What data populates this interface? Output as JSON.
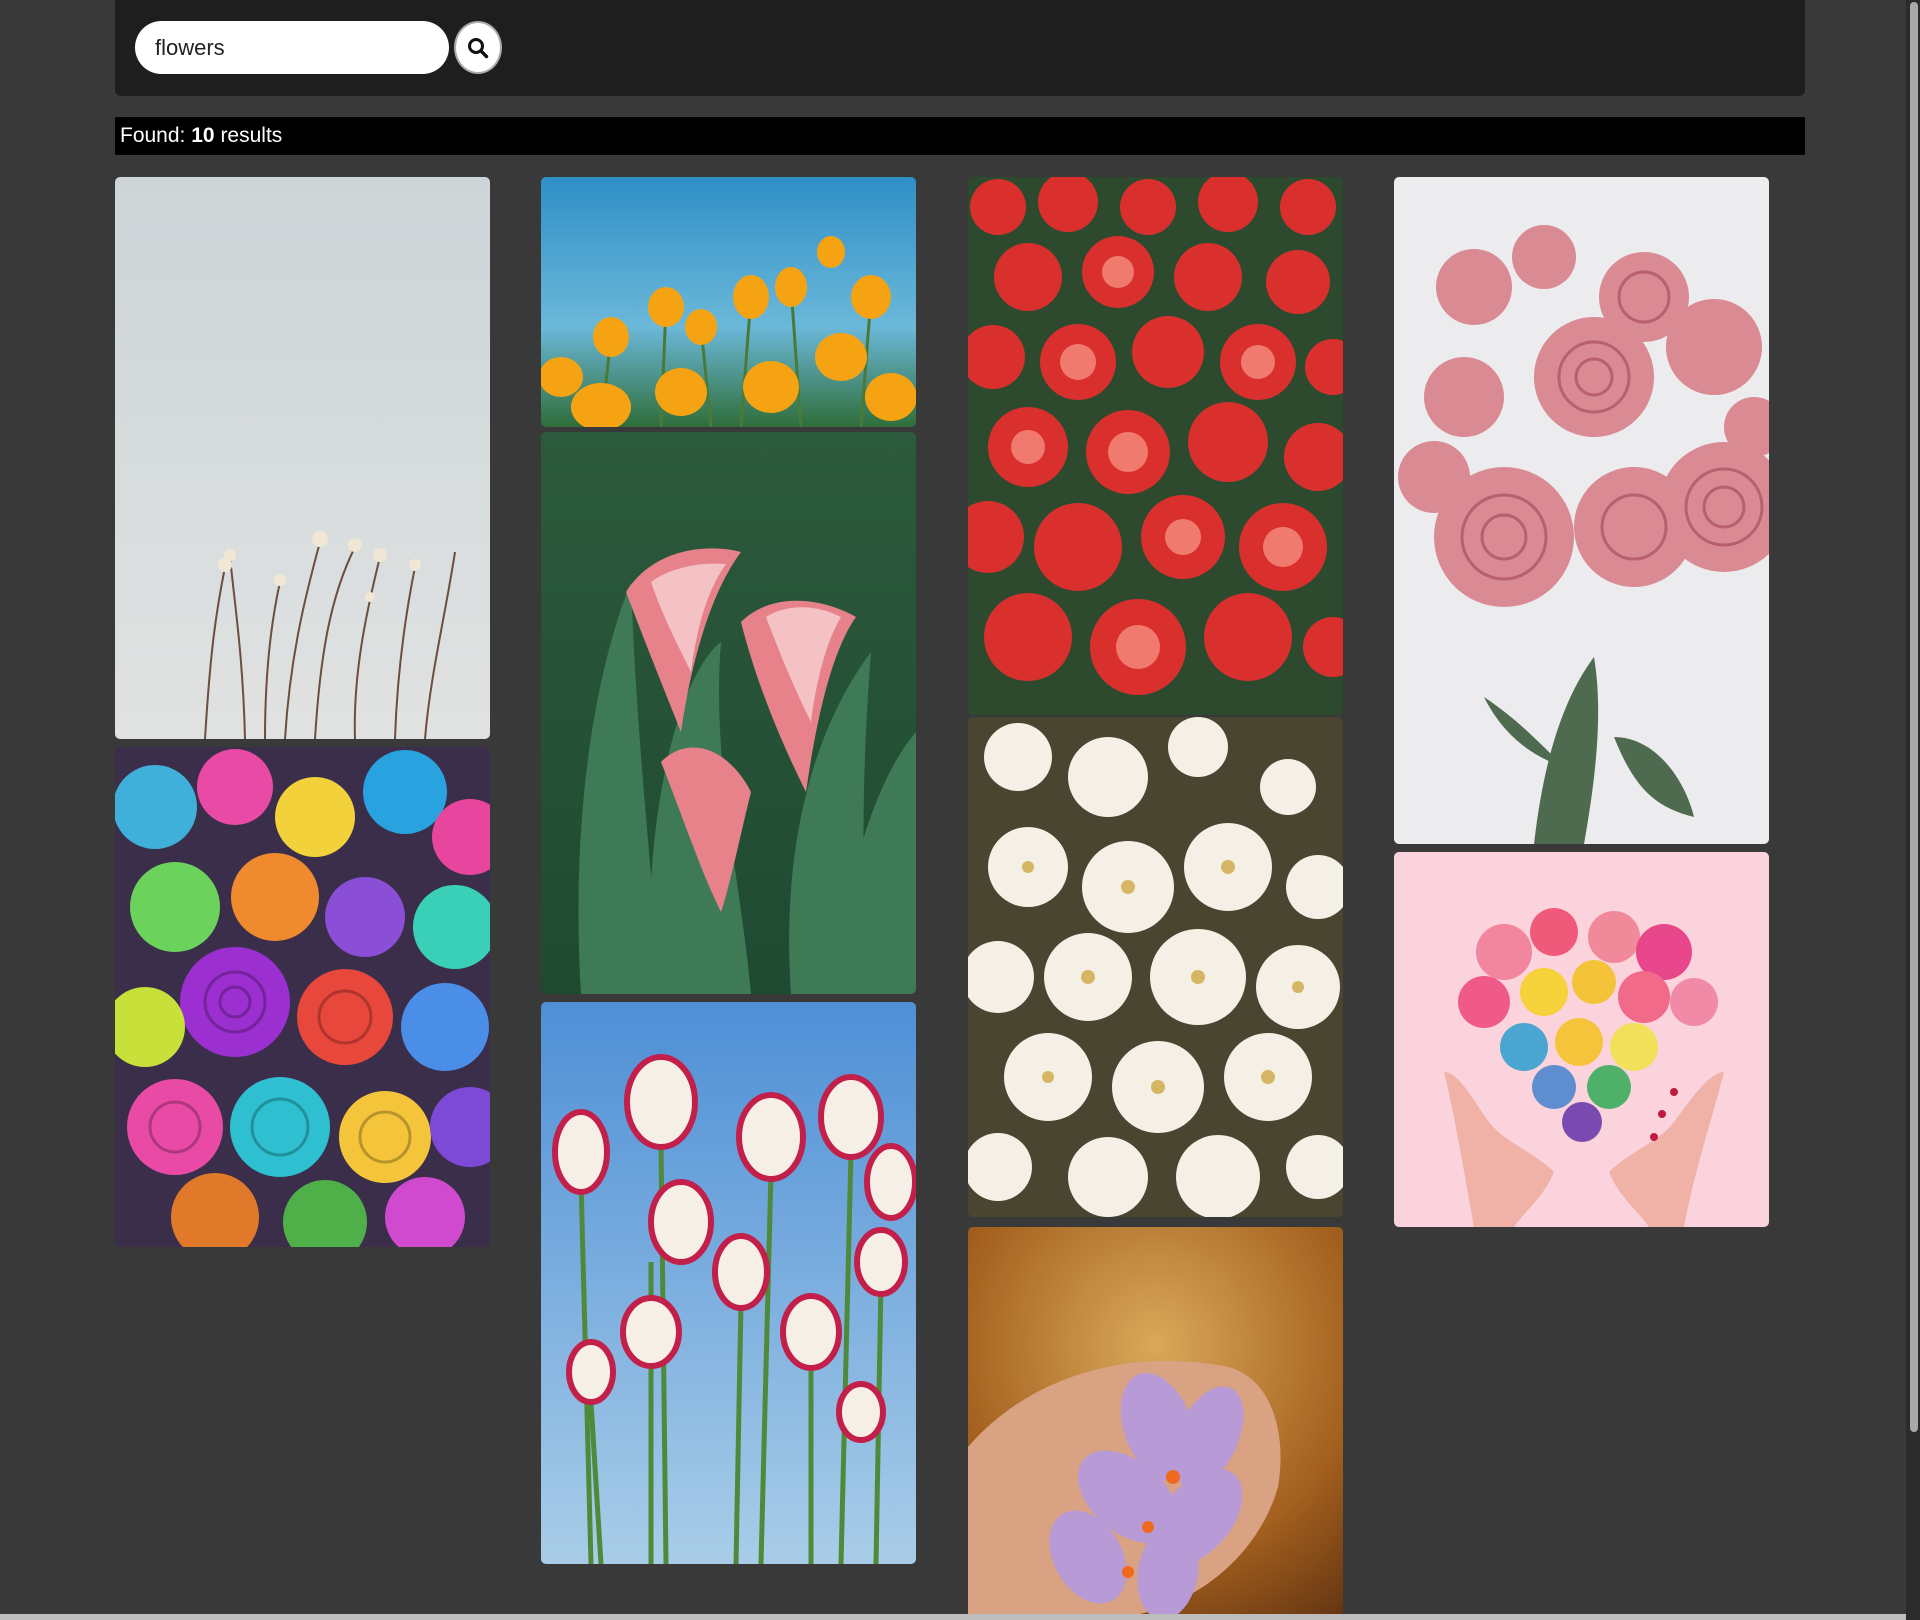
{
  "search": {
    "value": "flowers",
    "button_icon": "search-icon"
  },
  "results": {
    "label": "Found:",
    "count": "10",
    "suffix": "results"
  },
  "photos": [
    {
      "subject": "pale wildflowers against grey sky",
      "icon": "image"
    },
    {
      "subject": "rainbow dyed roses",
      "icon": "image"
    },
    {
      "subject": "orange poppies under blue sky",
      "icon": "image"
    },
    {
      "subject": "pink calla lilies",
      "icon": "image"
    },
    {
      "subject": "red and white tulips",
      "icon": "image"
    },
    {
      "subject": "red begonia field",
      "icon": "image"
    },
    {
      "subject": "white chrysanthemums",
      "icon": "image"
    },
    {
      "subject": "purple crocus in hand",
      "icon": "image"
    },
    {
      "subject": "pink peony bouquet",
      "icon": "image"
    },
    {
      "subject": "heart of flowers held by hands",
      "icon": "image"
    }
  ],
  "colors": {
    "background": "#393939",
    "topbar": "#1e1e1f",
    "results_bar": "#000000"
  }
}
